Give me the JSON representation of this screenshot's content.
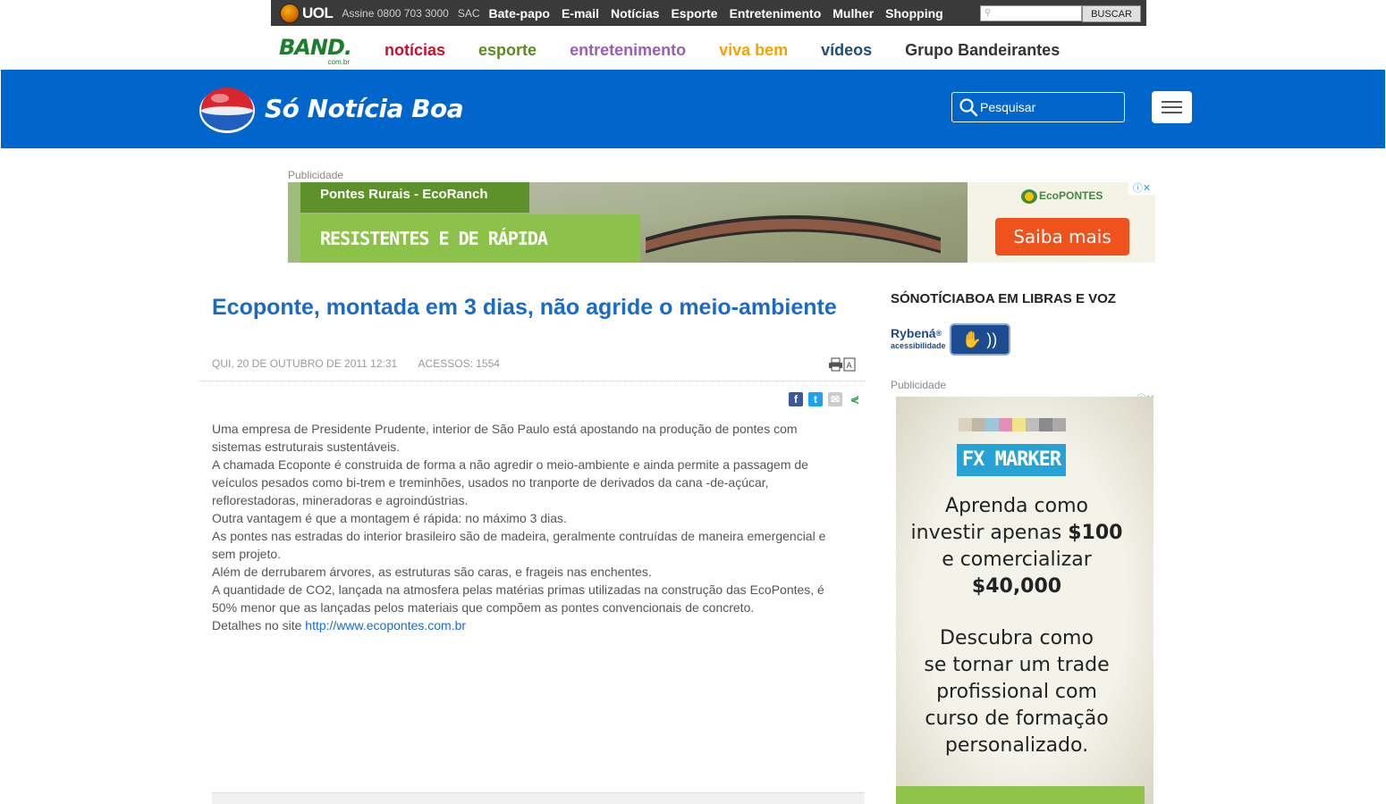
{
  "uol_bar": {
    "logo_text": "UOL",
    "assine": "Assine 0800 703 3000",
    "sac": "SAC",
    "links": [
      "Bate-papo",
      "E-mail",
      "Notícias",
      "Esporte",
      "Entretenimento",
      "Mulher",
      "Shopping"
    ],
    "search_button": "BUSCAR"
  },
  "band_bar": {
    "logo": "BAND.",
    "logo_suffix": "com.br",
    "nav": [
      {
        "label": "notícias",
        "color": "#c8102e"
      },
      {
        "label": "esporte",
        "color": "#5c8a1e"
      },
      {
        "label": "entretenimento",
        "color": "#9a5fb5"
      },
      {
        "label": "viva bem",
        "color": "#f0a500"
      },
      {
        "label": "vídeos",
        "color": "#1f4e79"
      },
      {
        "label": "Grupo Bandeirantes",
        "color": "#333333"
      }
    ]
  },
  "header": {
    "title": "Só Notícia Boa",
    "search_placeholder": "Pesquisar",
    "accent": "#0066cc"
  },
  "top_ad": {
    "label": "Publicidade",
    "line1": "Pontes Rurais - EcoRanch",
    "line2": "RESISTENTES E DE RÁPIDA MONTAGEM!",
    "brand": "EcoPONTES",
    "cta": "Saiba mais"
  },
  "article": {
    "title": "Ecoponte, montada em 3 dias, não agride o meio-ambiente",
    "date": "QUI, 20 DE OUTUBRO DE 2011 12:31",
    "accesses": "ACESSOS: 1554",
    "paragraphs": [
      "Uma empresa de Presidente Prudente, interior de São Paulo está apostando na produção de pontes com sistemas estruturais sustentáveis.",
      "A chamada Ecoponte é construida de forma a não agredir o meio-ambiente e ainda permite a passagem de veículos pesados como bi-trem e treminhões, usados no tranporte de derivados da cana -de-açúcar, reflorestadoras, mineradoras e agroindústrias.",
      "Outra vantagem é que a montagem é rápida: no máximo 3 dias.",
      "As pontes nas estradas do interior brasileiro são de madeira, geralmente contruídas de maneira emergencial e sem projeto.",
      "Além de derrubarem árvores, as estruturas são caras, e frageis nas enchentes.",
      "A quantidade de CO2, lançada na atmosfera pelas matérias primas utilizadas na construção das EcoPontes, é 50% menor que as lançadas pelos materiais que compõem as pontes convencionais de concreto."
    ],
    "details_prefix": "Detalhes no site ",
    "details_link": "http://www.ecopontes.com.br"
  },
  "sidebar": {
    "title": "SÓNOTÍCIABOA EM LIBRAS E VOZ",
    "rybena": "Rybená",
    "rybena_reg": "®",
    "rybena_sub": "acessibilidade",
    "ad_label": "Publicidade",
    "ad_brand": "FX MARKER",
    "ad_copy1_a": "Aprenda como",
    "ad_copy1_b": "investir apenas ",
    "ad_copy1_b_bold": "$100",
    "ad_copy1_c": "e comercializar",
    "ad_copy1_d": "$40,000",
    "ad_copy2_a": "Descubra como",
    "ad_copy2_b": "se tornar um trade",
    "ad_copy2_c": "profissional com",
    "ad_copy2_d": "curso de formação",
    "ad_copy2_e": "personalizado."
  }
}
